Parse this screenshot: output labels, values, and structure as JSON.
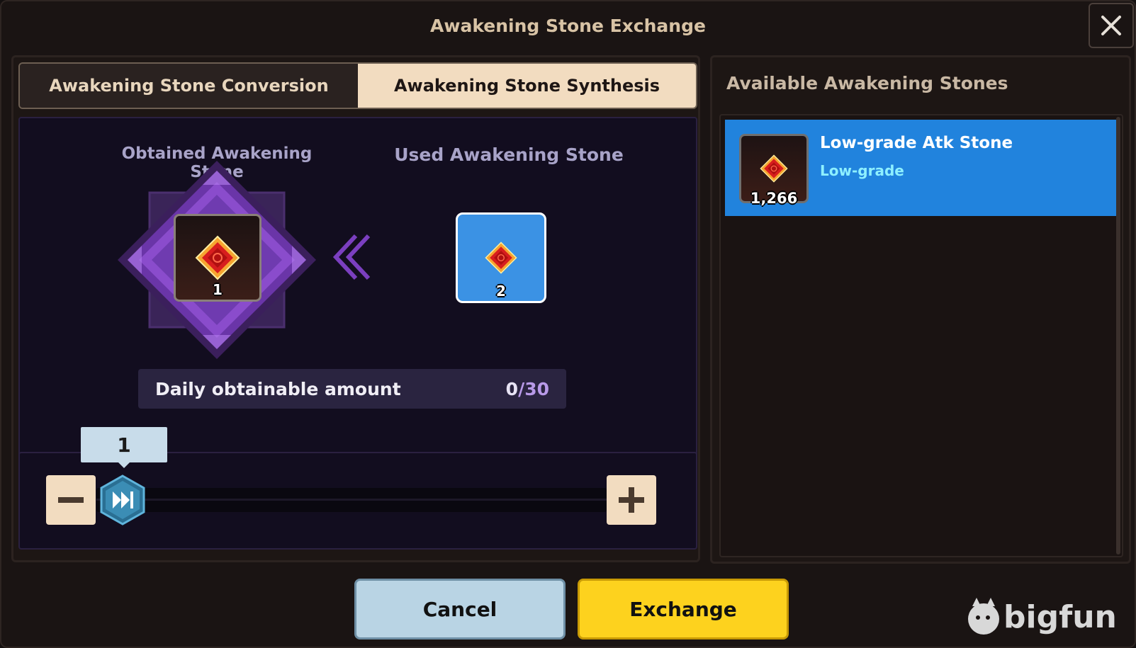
{
  "dialog": {
    "title": "Awakening Stone Exchange"
  },
  "tabs": [
    {
      "label": "Awakening Stone Conversion",
      "active": false
    },
    {
      "label": "Awakening Stone Synthesis",
      "active": true
    }
  ],
  "exchange": {
    "obtained_label": "Obtained Awakening Stone",
    "used_label": "Used Awakening Stone",
    "obtained_count": "1",
    "used_count": "2",
    "daily_label": "Daily obtainable amount",
    "daily_current": "0",
    "daily_separator": "/",
    "daily_max": "30"
  },
  "slider": {
    "value_label": "1",
    "fraction": 0
  },
  "right_panel": {
    "title": "Available Awakening Stones",
    "items": [
      {
        "name": "Low-grade Atk Stone",
        "grade": "Low-grade",
        "count": "1,266",
        "selected": true
      }
    ]
  },
  "buttons": {
    "cancel": "Cancel",
    "exchange": "Exchange"
  },
  "watermark": "bigfun",
  "colors": {
    "accent_blue": "#2183dd",
    "exchange_yellow": "#fdd21e",
    "grade_cyan": "#8ef0ff",
    "tab_active": "#f2dcc0"
  }
}
